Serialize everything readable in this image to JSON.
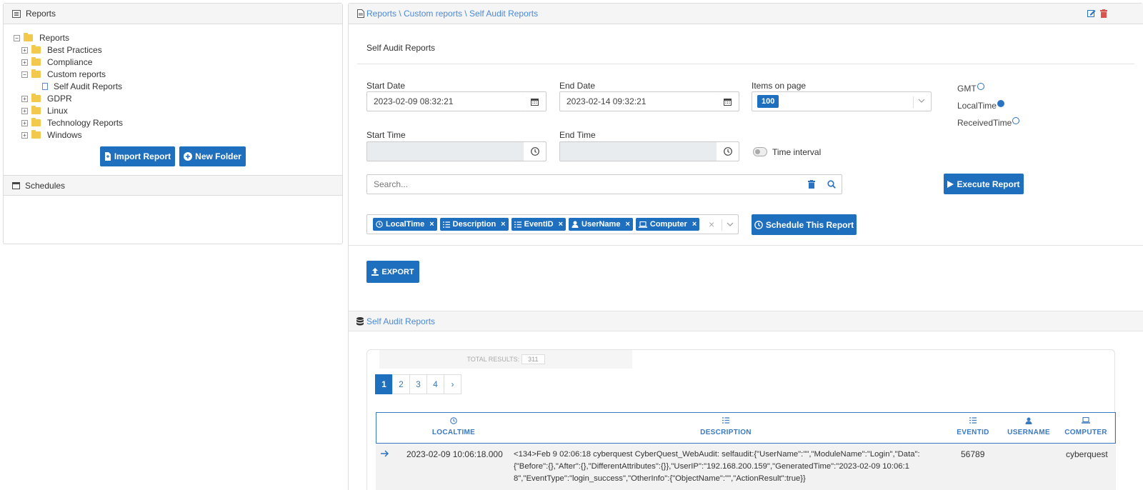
{
  "left_panel": {
    "title": "Reports",
    "tree": [
      {
        "label": "Reports",
        "level": 0,
        "type": "folder",
        "expander": "⊟"
      },
      {
        "label": "Best Practices",
        "level": 1,
        "type": "folder",
        "expander": "⊞"
      },
      {
        "label": "Compliance",
        "level": 1,
        "type": "folder",
        "expander": "⊞"
      },
      {
        "label": "Custom reports",
        "level": 1,
        "type": "folder",
        "expander": "⊟"
      },
      {
        "label": "Self Audit Reports",
        "level": 2,
        "type": "doc",
        "expander": ""
      },
      {
        "label": "GDPR",
        "level": 1,
        "type": "folder",
        "expander": "⊞"
      },
      {
        "label": "Linux",
        "level": 1,
        "type": "folder",
        "expander": "⊞"
      },
      {
        "label": "Technology Reports",
        "level": 1,
        "type": "folder",
        "expander": "⊞"
      },
      {
        "label": "Windows",
        "level": 1,
        "type": "folder",
        "expander": "⊞"
      }
    ],
    "import_label": "Import Report",
    "new_folder_label": "New Folder",
    "schedules_title": "Schedules"
  },
  "breadcrumb": {
    "text": "Reports \\ Custom reports \\ Self Audit Reports"
  },
  "form": {
    "heading": "Self Audit Reports",
    "start_date_label": "Start Date",
    "start_date_value": "2023-02-09 08:32:21",
    "end_date_label": "End Date",
    "end_date_value": "2023-02-14 09:32:21",
    "items_on_page_label": "Items on page",
    "items_on_page_value": "100",
    "start_time_label": "Start Time",
    "end_time_label": "End Time",
    "time_interval_label": "Time interval",
    "tz_options": [
      {
        "label": "GMT",
        "checked": false
      },
      {
        "label": "LocalTime",
        "checked": true
      },
      {
        "label": "ReceivedTime",
        "checked": false
      }
    ],
    "search_placeholder": "Search...",
    "execute_label": "Execute Report",
    "columns": [
      "LocalTime",
      "Description",
      "EventID",
      "UserName",
      "Computer"
    ],
    "schedule_label": "Schedule This Report",
    "export_label": "EXPORT"
  },
  "results": {
    "section_title": "Self Audit Reports",
    "total_label": "TOTAL RESULTS:",
    "total_value": "311",
    "pages": [
      "1",
      "2",
      "3",
      "4",
      "›"
    ],
    "active_page": "1",
    "headers": [
      "LOCALTIME",
      "DESCRIPTION",
      "EVENTID",
      "USERNAME",
      "COMPUTER"
    ],
    "rows": [
      {
        "localtime": "2023-02-09 10:06:18.000",
        "description": "<134>Feb 9 02:06:18 cyberquest CyberQuest_WebAudit: selfaudit:{\"UserName\":\"\",\"ModuleName\":\"Login\",\"Data\":{\"Before\":{},\"After\":{},\"DifferentAttributes\":{}},\"UserIP\":\"192.168.200.159\",\"GeneratedTime\":\"2023-02-09 10:06:18\",\"EventType\":\"login_success\",\"OtherInfo\":{\"ObjectName\":\"\",\"ActionResult\":true}}",
        "eventid": "56789",
        "username": "",
        "computer": "cyberquest"
      }
    ]
  },
  "colors": {
    "primary": "#1f6fbf",
    "link": "#4a8ad8",
    "header_bg": "#f5f5f5"
  }
}
